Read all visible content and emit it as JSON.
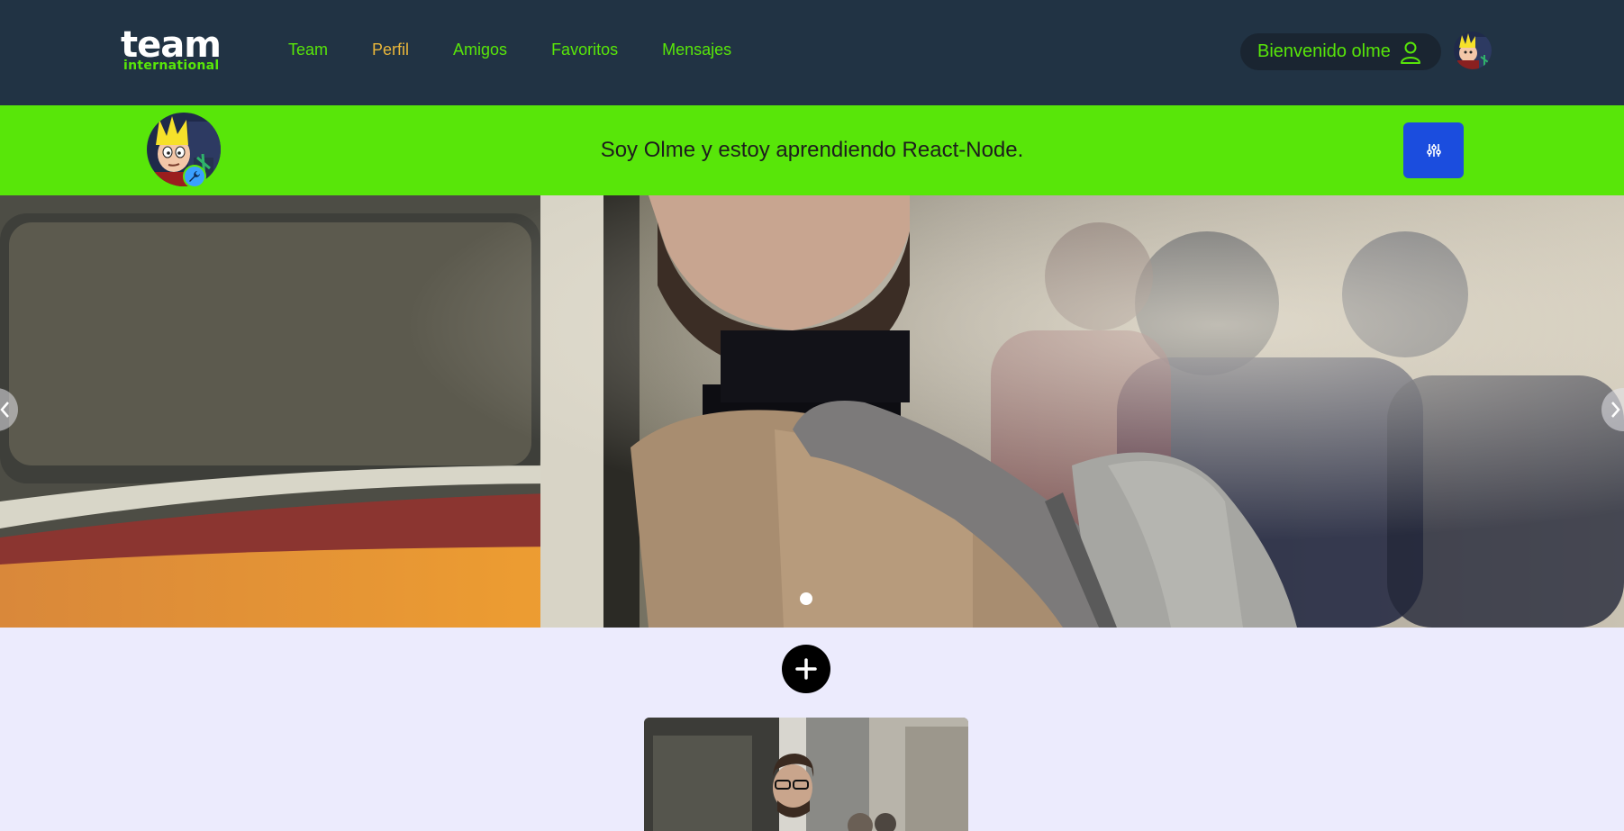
{
  "app": {
    "logo_main": "team",
    "logo_sub": "international"
  },
  "nav": {
    "links": [
      {
        "label": "Team",
        "active": false
      },
      {
        "label": "Perfil",
        "active": true
      },
      {
        "label": "Amigos",
        "active": false
      },
      {
        "label": "Favoritos",
        "active": false
      },
      {
        "label": "Mensajes",
        "active": false
      }
    ],
    "welcome_label": "Bienvenido olme",
    "user_icon": "user-icon",
    "avatar_icon": "avatar"
  },
  "profile": {
    "bio": "Soy Olme y estoy aprendiendo React-Node.",
    "badge_icon": "wrench-icon",
    "settings_icon": "sliders-icon"
  },
  "carousel": {
    "prev_icon": "chevron-left-icon",
    "next_icon": "chevron-right-icon",
    "slide_count": 1,
    "active_index": 0
  },
  "actions": {
    "add_icon": "plus-icon"
  },
  "colors": {
    "navbar_bg": "#213344",
    "accent_green": "#58e609",
    "active_link": "#e9b63a",
    "settings_button": "#1b4dde",
    "page_bg": "#ecebfd"
  }
}
